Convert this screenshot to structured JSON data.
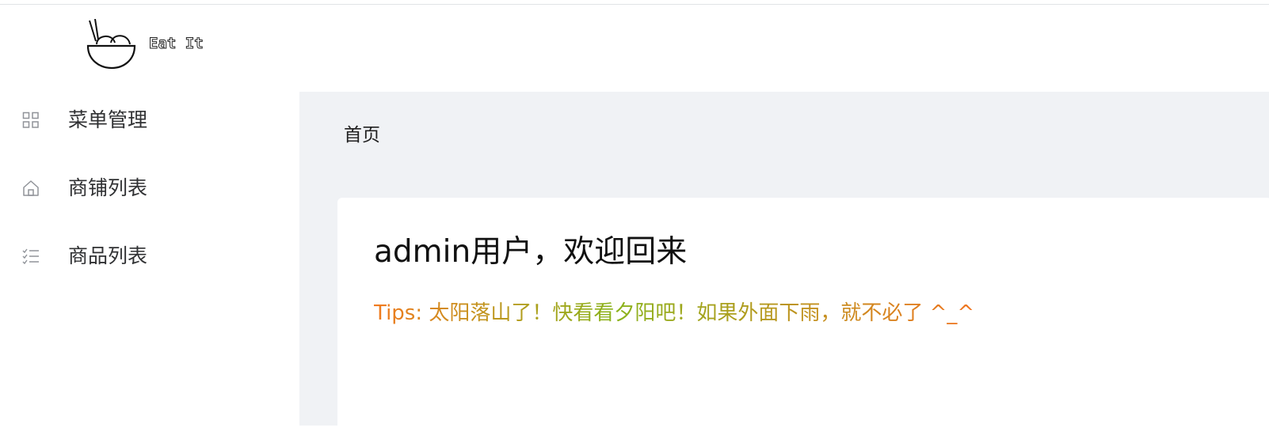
{
  "app": {
    "logo_text": "Eat It"
  },
  "sidebar": {
    "items": [
      {
        "label": "菜单管理",
        "icon": "grid-icon"
      },
      {
        "label": "商铺列表",
        "icon": "house-icon"
      },
      {
        "label": "商品列表",
        "icon": "checklist-icon"
      }
    ]
  },
  "main": {
    "breadcrumb": "首页",
    "welcome": "admin用户，欢迎回来",
    "tips": "Tips: 太阳落山了！快看看夕阳吧！如果外面下雨，就不必了 ^_^"
  },
  "colors": {
    "main_bg": "#f0f2f5",
    "tips_gradient_start": "#f17a1f",
    "tips_gradient_mid": "#8ab31c",
    "tips_gradient_end": "#f0741f"
  }
}
